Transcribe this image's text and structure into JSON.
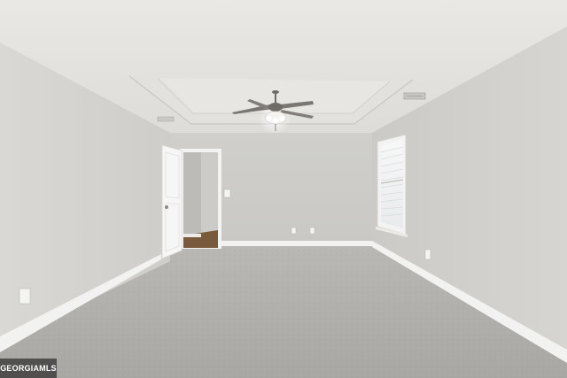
{
  "scene": {
    "description_tags": [
      "empty-bedroom",
      "carpet",
      "tray-ceiling",
      "ceiling-fan",
      "window",
      "open-door"
    ],
    "colors": {
      "wall": "#d6d5d1",
      "ceiling": "#e6e5e1",
      "carpet": "#b4b2ae",
      "trim": "#f4f4f2",
      "fan": "#6e6a66"
    }
  },
  "watermark": {
    "text": "GEORGIAMLS"
  }
}
